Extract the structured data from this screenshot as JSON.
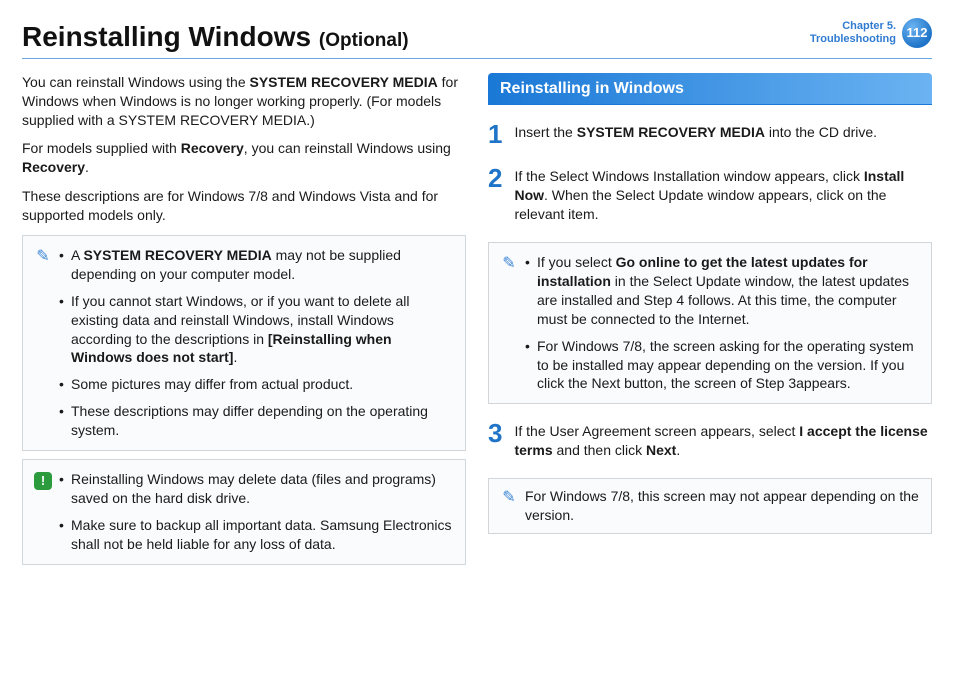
{
  "header": {
    "title": "Reinstalling Windows",
    "subtitle": "(Optional)",
    "chapter_line1": "Chapter 5.",
    "chapter_line2": "Troubleshooting",
    "page_number": "112"
  },
  "left": {
    "p1_pre": "You can reinstall Windows using the ",
    "p1_bold": "SYSTEM RECOVERY MEDIA",
    "p1_post": " for Windows when Windows is no longer working properly.  (For models supplied with a SYSTEM RECOVERY MEDIA.)",
    "p2_pre": "For models supplied with ",
    "p2_b1": "Recovery",
    "p2_mid": ", you can reinstall Windows using ",
    "p2_b2": "Recovery",
    "p2_post": ".",
    "p3": "These descriptions are for Windows 7/8 and Windows Vista and for supported models only.",
    "note1": {
      "li1_pre": "A ",
      "li1_bold": "SYSTEM RECOVERY MEDIA",
      "li1_post": " may not be supplied depending on your computer model.",
      "li2_pre": "If you cannot start Windows, or if you want to delete all existing data and reinstall Windows, install Windows according to the descriptions in ",
      "li2_bold": "[Reinstalling when Windows does not start]",
      "li2_post": ".",
      "li3": "Some pictures may differ from actual product.",
      "li4": "These descriptions may differ depending on the operating system."
    },
    "note2": {
      "li1": "Reinstalling Windows may delete data (files and programs) saved on the hard disk drive.",
      "li2": "Make sure to backup all important data. Samsung Electronics shall not be held liable for any loss of data."
    }
  },
  "right": {
    "section_title": "Reinstalling in Windows",
    "step1": {
      "num": "1",
      "pre": "Insert the ",
      "bold": "SYSTEM RECOVERY MEDIA",
      "post": " into the CD drive."
    },
    "step2": {
      "num": "2",
      "pre": "If the Select Windows Installation window appears, click ",
      "bold": "Install Now",
      "post": ". When the Select Update window appears, click on the relevant item."
    },
    "note": {
      "li1_pre": "If you select ",
      "li1_bold": "Go online to get the latest updates for installation",
      "li1_post": " in the Select Update window, the latest updates are installed and Step 4 follows. At this time, the computer must be connected to the Internet.",
      "li2": "For Windows 7/8, the screen asking for the operating system to be installed may appear depending on the version. If you click the Next button, the screen of Step 3appears."
    },
    "step3": {
      "num": "3",
      "pre": "If the User Agreement screen appears, select ",
      "b1": "I accept the license terms",
      "mid": " and then click ",
      "b2": "Next",
      "post": "."
    },
    "note2": "For Windows 7/8, this screen may not appear depending on the version."
  }
}
